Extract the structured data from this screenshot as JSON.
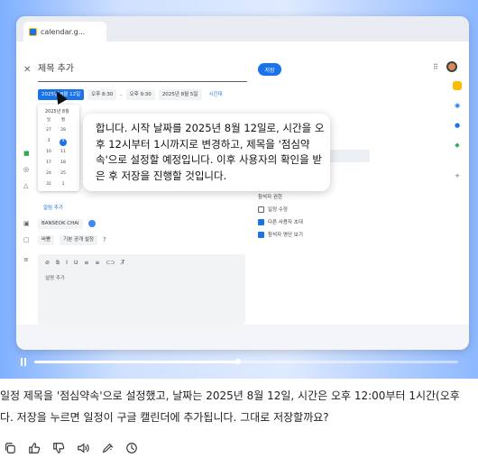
{
  "browser": {
    "tab_title": "calendar.g..."
  },
  "event": {
    "close_icon": "close-icon",
    "title_placeholder": "제목 추가",
    "save_label": "저장",
    "date_selected": "2025년 8월 12일",
    "start_time": "오후 8:30",
    "dash": "-",
    "end_time": "오후 9:30",
    "end_date": "2025년 8월 5일",
    "timezone_link": "시간대",
    "mini_calendar": {
      "month": "2025년 8월",
      "cells": [
        [
          "일",
          "월"
        ],
        [
          "27",
          "28"
        ],
        [
          "3",
          "4"
        ],
        [
          "10",
          "11"
        ],
        [
          "17",
          "18"
        ],
        [
          "24",
          "25"
        ],
        [
          "31",
          "1"
        ]
      ]
    },
    "add_notification": "알림 추가",
    "calendar_owner": "BANSEOK CHAI",
    "busy_label": "바쁨",
    "visibility_label": "기본 공개 설정",
    "description_placeholder": "설명 추가",
    "format_tools": [
      "⊘",
      "B",
      "I",
      "U",
      "≡",
      "≡",
      "⊂⊃",
      "T̸"
    ]
  },
  "guest_permissions": {
    "title": "참석자 권한",
    "options": [
      {
        "label": "일정 수정",
        "checked": false
      },
      {
        "label": "다른 사용자 초대",
        "checked": true
      },
      {
        "label": "참석자 명단 보기",
        "checked": true
      }
    ]
  },
  "tooltip": {
    "text": "합니다. 시작 날짜를 2025년 8월 12일로, 시간을 오후 12시부터 1시까지로 변경하고, 제목을 '점심약속'으로 설정할 예정입니다. 이후 사용자의 확인을 받은 후 저장을 진행할 것입니다."
  },
  "video": {
    "progress": 0.48
  },
  "chat": {
    "line1": "일정 제목을 '점심약속'으로 설정했고, 날짜는 2025년 8월 12일, 시간은 오후 12:00부터 1시간(오후",
    "line2": "다. 저장을 누르면 일정이 구글 캘린더에 추가됩니다. 그대로 저장할까요?"
  },
  "actions": [
    "copy-icon",
    "thumbs-up-icon",
    "thumbs-down-icon",
    "speaker-icon",
    "edit-icon",
    "history-icon"
  ]
}
